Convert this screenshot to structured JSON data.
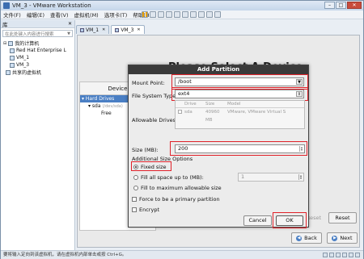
{
  "window": {
    "title": "VM_3 - VMware Workstation",
    "controls": {
      "minimize": "–",
      "maximize": "□",
      "close": "✕"
    }
  },
  "menubar": {
    "items": [
      "文件(F)",
      "编辑(E)",
      "查看(V)",
      "虚拟机(M)",
      "选项卡(T)",
      "帮助(H)"
    ]
  },
  "library": {
    "header": "库",
    "close": "✕",
    "search_placeholder": "在此处键入内容进行搜索",
    "tree": {
      "root": "我的计算机",
      "children": [
        "Red Hat Enterprise L",
        "VM_1",
        "VM_3"
      ],
      "shared": "共享的虚拟机"
    }
  },
  "tabs": [
    {
      "label": "VM_1",
      "close": "✕"
    },
    {
      "label": "VM_3",
      "close": "✕"
    }
  ],
  "installer": {
    "heading": "Please Select A Device",
    "device_column": "Device",
    "tree": {
      "selected": "Hard Drives",
      "disk": "sda",
      "disk_path": "(/dev/sda)",
      "free": "Free"
    },
    "reset_label": "Reset",
    "back_label": "Back",
    "next_label": "Next",
    "hidden_button_label": "Reset"
  },
  "dialog": {
    "title": "Add Partition",
    "mount_point_label": "Mount Point:",
    "mount_point_value": "/boot",
    "fs_type_label": "File System Type:",
    "fs_type_value": "ext4",
    "allowable_drives_label": "Allowable Drives:",
    "drives_columns": [
      "",
      "Drive",
      "Size",
      "Model"
    ],
    "drives_rows": [
      {
        "checked": true,
        "drive": "sda",
        "size": "40960 MB",
        "model": "VMware, VMware Virtual S"
      }
    ],
    "size_label": "Size (MB):",
    "size_value": "200",
    "additional_options_label": "Additional Size Options",
    "option_fixed": "Fixed size",
    "option_fill_upto": "Fill all space up to (MB):",
    "fill_upto_value": "1",
    "option_fill_max": "Fill to maximum allowable size",
    "primary_partition_label": "Force to be a primary partition",
    "encrypt_label": "Encrypt",
    "cancel_label": "Cancel",
    "ok_label": "OK",
    "selected_size_option": "fixed"
  },
  "statusbar": {
    "text": "要将输入定向到该虚拟机，请在虚拟机内部单击或按 Ctrl+G。"
  },
  "colors": {
    "highlight_red": "#e0222a",
    "selection_blue": "#4a7fc4",
    "dialog_title_bg": "#3a3a3a"
  }
}
